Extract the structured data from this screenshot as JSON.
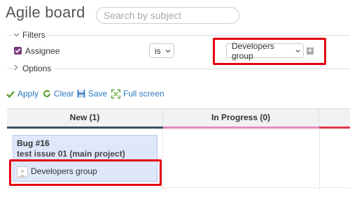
{
  "page": {
    "title": "Agile board"
  },
  "search": {
    "placeholder": "Search by subject"
  },
  "filters": {
    "legend": "Filters",
    "assignee": {
      "label": "Assignee",
      "operator": "is",
      "value": "Developers group"
    }
  },
  "options": {
    "legend": "Options"
  },
  "actions": {
    "apply": "Apply",
    "clear": "Clear",
    "save": "Save",
    "fullscreen": "Full screen"
  },
  "board": {
    "columns": [
      {
        "label": "New (1)",
        "color": "#3b4f63"
      },
      {
        "label": "In Progress (0)",
        "color": "#e48bbd"
      },
      {
        "label": "",
        "color": "#e3394a"
      }
    ],
    "card": {
      "title": "Bug #16",
      "subject": "test issue 01 (main project)",
      "assignee": "Developers group"
    }
  },
  "colors": {
    "highlight": "#e3000f",
    "link": "#2a7abf",
    "checkbox": "#7b3a7f",
    "card_bg": "#dfe7fb"
  }
}
